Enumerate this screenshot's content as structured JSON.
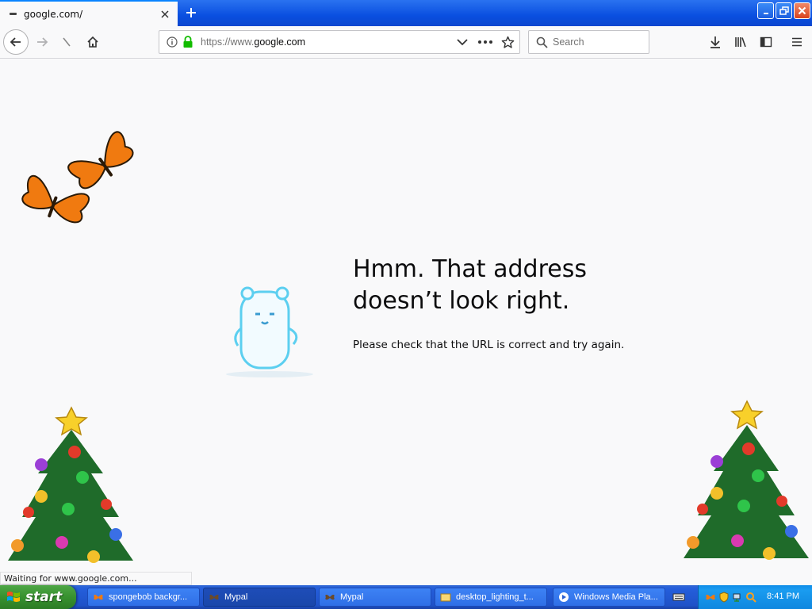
{
  "browser": {
    "tab_title": "google.com/",
    "url_prefix": "https://www.",
    "url_domain": "google.com",
    "search_placeholder": "Search"
  },
  "error": {
    "title_line1": "Hmm. That address",
    "title_line2": "doesn’t look right.",
    "message": "Please check that the URL is correct and try again."
  },
  "status": "Waiting for www.google.com...",
  "taskbar": {
    "start_label": "start",
    "tasks": [
      {
        "label": "spongebob backgr..."
      },
      {
        "label": "Mypal"
      },
      {
        "label": "Mypal"
      },
      {
        "label": "desktop_lighting_t..."
      },
      {
        "label": "Windows Media Pla..."
      }
    ],
    "clock": "8:41 PM"
  },
  "colors": {
    "accent": "#0a84ff",
    "taskbar": "#245edb",
    "start": "#37912f",
    "secure": "#12bc00"
  }
}
